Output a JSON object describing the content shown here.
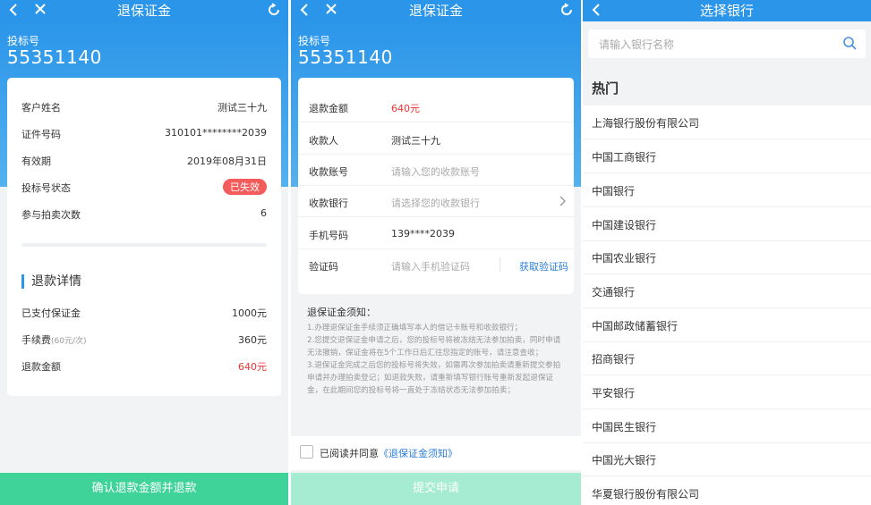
{
  "screen1": {
    "title": "退保证金",
    "bid_label": "投标号",
    "bid_number": "55351140",
    "info": [
      {
        "label": "客户姓名",
        "value": "测试三十九"
      },
      {
        "label": "证件号码",
        "value": "310101********2039"
      },
      {
        "label": "有效期",
        "value": "2019年08月31日"
      },
      {
        "label": "投标号状态",
        "value": "已失效"
      },
      {
        "label": "参与拍卖次数",
        "value": "6"
      }
    ],
    "refund_section_title": "退款详情",
    "refund": [
      {
        "label": "已支付保证金",
        "value": "1000元"
      },
      {
        "label": "手续费",
        "sub": "(60元/次)",
        "value": "360元"
      },
      {
        "label": "退款金额",
        "value": "640元"
      }
    ],
    "confirm_button": "确认退款金额并退款"
  },
  "screen2": {
    "title": "退保证金",
    "bid_label": "投标号",
    "bid_number": "55351140",
    "form": [
      {
        "label": "退款金额",
        "value": "640元"
      },
      {
        "label": "收款人",
        "value": "测试三十九"
      },
      {
        "label": "收款账号",
        "placeholder": "请输入您的收款账号"
      },
      {
        "label": "收款银行",
        "placeholder": "请选择您的收款银行"
      },
      {
        "label": "手机号码",
        "value": "139****2039"
      },
      {
        "label": "验证码",
        "placeholder": "请输入手机验证码",
        "action": "获取验证码"
      }
    ],
    "notice_title": "退保证金须知：",
    "notice_items": [
      "1.办理退保证金手续须正确填写本人的借记卡账号和收款银行；",
      "2.您提交退保证金申请之后，您的投标号将被冻结无法参加拍卖，同时申请无法撤销，保证金将在5个工作日后汇往您指定的账号，请注意查收；",
      "3.退保证金完成之后您的投标号将失效，如需再次参加拍卖请重新提交参拍申请并办理拍卖登记；如退款失败，请重新填写银行账号重新发起退保证金，在此期间您的投标号将一直处于冻结状态无法参加拍卖；"
    ],
    "agree_text": "已阅读并同意",
    "agree_link": "《退保证金须知》",
    "submit_button": "提交申请"
  },
  "screen3": {
    "title": "选择银行",
    "search_placeholder": "请输入银行名称",
    "hot_label": "热门",
    "banks": [
      "上海银行股份有限公司",
      "中国工商银行",
      "中国银行",
      "中国建设银行",
      "中国农业银行",
      "交通银行",
      "中国邮政储蓄银行",
      "招商银行",
      "平安银行",
      "中国民生银行",
      "中国光大银行",
      "华夏银行股份有限公司"
    ]
  },
  "colors": {
    "brand_blue": "#2b95e9",
    "primary_green": "#3fd39a",
    "disabled_green": "#a6ecd2",
    "alert_red": "#e33333"
  }
}
